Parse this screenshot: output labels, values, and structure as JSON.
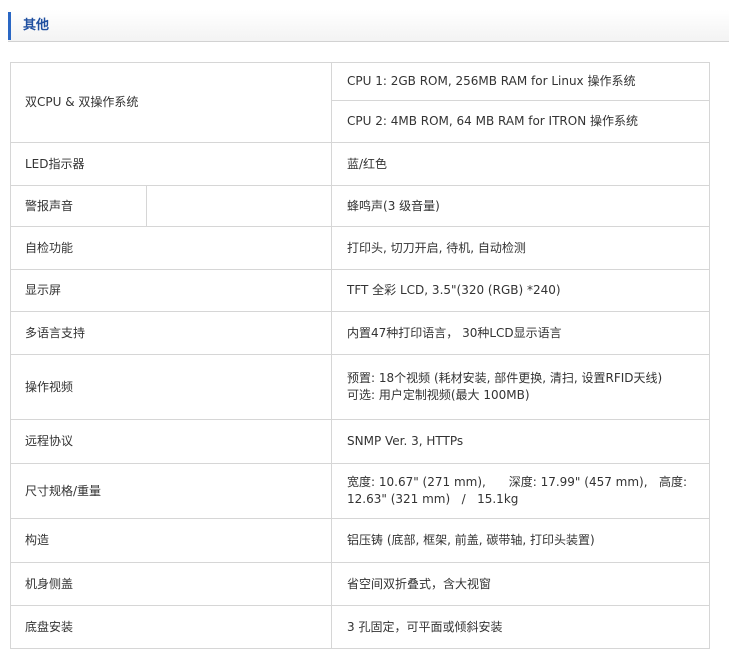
{
  "section": {
    "title": "其他"
  },
  "rows": {
    "cpu": {
      "label": "双CPU & 双操作系统",
      "value1": "CPU 1: 2GB ROM, 256MB RAM for Linux 操作系统",
      "value2": "CPU 2: 4MB ROM, 64 MB RAM for ITRON 操作系统"
    },
    "led": {
      "label": "LED指示器",
      "value": "蓝/红色"
    },
    "alarm": {
      "label": "警报声音",
      "value": "蜂鸣声(3 级音量)"
    },
    "selftest": {
      "label": "自检功能",
      "value": "打印头, 切刀开启, 待机, 自动检测"
    },
    "display": {
      "label": "显示屏",
      "value": "TFT 全彩 LCD, 3.5\"(320 (RGB) *240)"
    },
    "language": {
      "label": "多语言支持",
      "value": "内置47种打印语言， 30种LCD显示语言"
    },
    "video": {
      "label": "操作视频",
      "value1": "预置: 18个视频 (耗材安装, 部件更换, 清扫, 设置RFID天线)",
      "value2": "可选: 用户定制视频(最大 100MB)"
    },
    "remote": {
      "label": "远程协议",
      "value": "SNMP Ver. 3, HTTPs"
    },
    "size": {
      "label": "尺寸规格/重量",
      "value1": "宽度: 10.67\" (271 mm),      深度: 17.99\" (457 mm),   高度:",
      "value2": "12.63\" (321 mm)   /   15.1kg"
    },
    "construction": {
      "label": "构造",
      "value": "铝压铸 (底部, 框架, 前盖, 碳带轴, 打印头装置)"
    },
    "cover": {
      "label": "机身侧盖",
      "value": "省空间双折叠式，含大视窗"
    },
    "base": {
      "label": "底盘安装",
      "value": "3 孔固定，可平面或倾斜安装"
    }
  }
}
